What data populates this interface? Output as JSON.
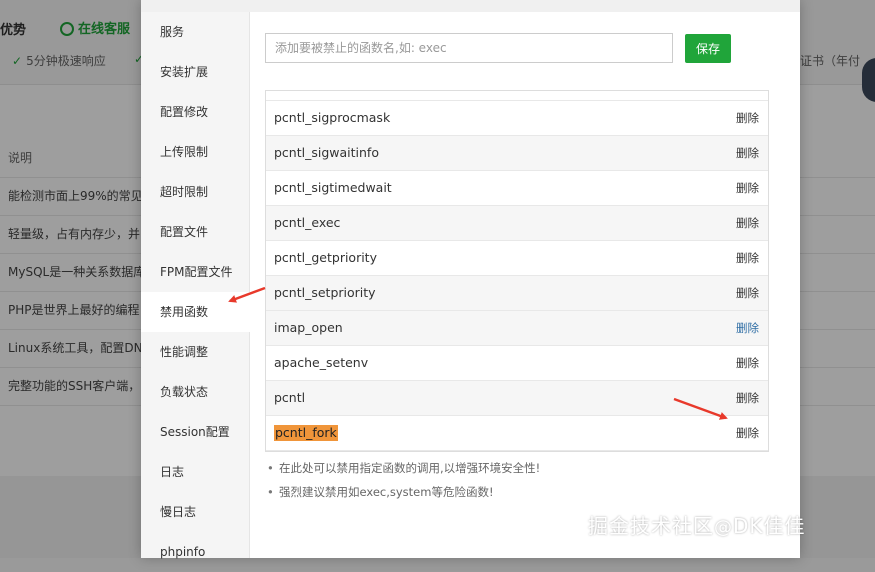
{
  "background": {
    "advantage_label": "优势",
    "online_service_label": "在线客服",
    "fast_response_label": "5分钟极速响应",
    "cert_label": "证书（年付",
    "table_header": "说明",
    "rows": [
      "能检测市面上99%的常见",
      "轻量级，占有内存少，并",
      "MySQL是一种关系数据库",
      "PHP是世界上最好的编程",
      "Linux系统工具，配置DN",
      "完整功能的SSH客户端，"
    ]
  },
  "sidebar": {
    "items": [
      {
        "label": "服务"
      },
      {
        "label": "安装扩展"
      },
      {
        "label": "配置修改"
      },
      {
        "label": "上传限制"
      },
      {
        "label": "超时限制"
      },
      {
        "label": "配置文件"
      },
      {
        "label": "FPM配置文件"
      },
      {
        "label": "禁用函数"
      },
      {
        "label": "性能调整"
      },
      {
        "label": "负载状态"
      },
      {
        "label": "Session配置"
      },
      {
        "label": "日志"
      },
      {
        "label": "慢日志"
      },
      {
        "label": "phpinfo"
      }
    ],
    "active": "禁用函数"
  },
  "form": {
    "input_placeholder": "添加要被禁止的函数名,如: exec",
    "input_value": "",
    "save_label": "保存"
  },
  "functions": {
    "delete_label": "删除",
    "items": [
      {
        "name": "pcntl_sigprocmask",
        "highlighted": false
      },
      {
        "name": "pcntl_sigwaitinfo",
        "highlighted": false
      },
      {
        "name": "pcntl_sigtimedwait",
        "highlighted": false
      },
      {
        "name": "pcntl_exec",
        "highlighted": false
      },
      {
        "name": "pcntl_getpriority",
        "highlighted": false
      },
      {
        "name": "pcntl_setpriority",
        "highlighted": false
      },
      {
        "name": "imap_open",
        "highlighted": false
      },
      {
        "name": "apache_setenv",
        "highlighted": false
      },
      {
        "name": "pcntl",
        "highlighted": false
      },
      {
        "name": "pcntl_fork",
        "highlighted": true
      }
    ]
  },
  "tips": [
    "在此处可以禁用指定函数的调用,以增强环境安全性!",
    "强烈建议禁用如exec,system等危险函数!"
  ],
  "watermark": {
    "text": "掘金技术社区",
    "at_text": "@",
    "author": "DK佳佳"
  },
  "colors": {
    "accent_green": "#20a53a",
    "highlight_orange": "#f0953a",
    "annotation_red": "#e8392b"
  }
}
